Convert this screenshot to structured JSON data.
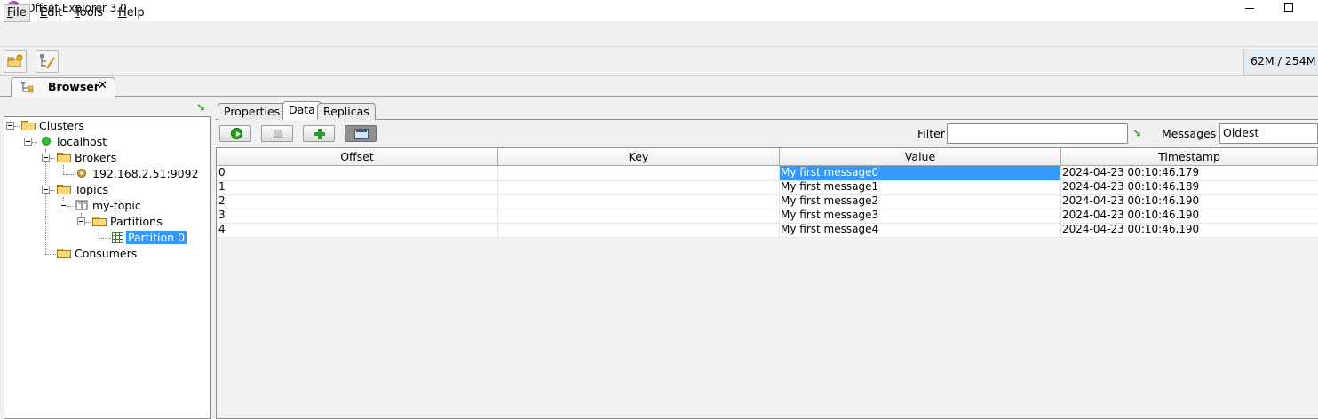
{
  "window": {
    "title": "Offset Explorer  3.0"
  },
  "menu": {
    "items": [
      {
        "accel": "F",
        "rest": "ile"
      },
      {
        "accel": "E",
        "rest": "dit"
      },
      {
        "accel": "T",
        "rest": "ools"
      },
      {
        "accel": "H",
        "rest": "elp"
      }
    ]
  },
  "toolbar": {
    "memory": "62M / 254M"
  },
  "browser_tab": {
    "label": "Browser",
    "close": "✕"
  },
  "tree": {
    "clusters": "Clusters",
    "localhost": "localhost",
    "brokers": "Brokers",
    "broker_address": "192.168.2.51:9092",
    "topics": "Topics",
    "topic_name": "my-topic",
    "partitions": "Partitions",
    "partition": "Partition 0",
    "consumers": "Consumers"
  },
  "data_tabs": [
    "Properties",
    "Data",
    "Replicas"
  ],
  "filter": {
    "label": "Filter",
    "value": ""
  },
  "messages": {
    "label": "Messages",
    "selected": "Oldest"
  },
  "table": {
    "columns": [
      "Offset",
      "Key",
      "Value",
      "Timestamp"
    ],
    "rows": [
      {
        "offset": "0",
        "key": "",
        "value": "My first message0",
        "timestamp": "2024-04-23 00:10:46.179"
      },
      {
        "offset": "1",
        "key": "",
        "value": "My first message1",
        "timestamp": "2024-04-23 00:10:46.189"
      },
      {
        "offset": "2",
        "key": "",
        "value": "My first message2",
        "timestamp": "2024-04-23 00:10:46.190"
      },
      {
        "offset": "3",
        "key": "",
        "value": "My first message3",
        "timestamp": "2024-04-23 00:10:46.190"
      },
      {
        "offset": "4",
        "key": "",
        "value": "My first message4",
        "timestamp": "2024-04-23 00:10:46.190"
      }
    ]
  },
  "colors": {
    "selection": "#3399ff",
    "connected_status": "#2bc22b"
  }
}
